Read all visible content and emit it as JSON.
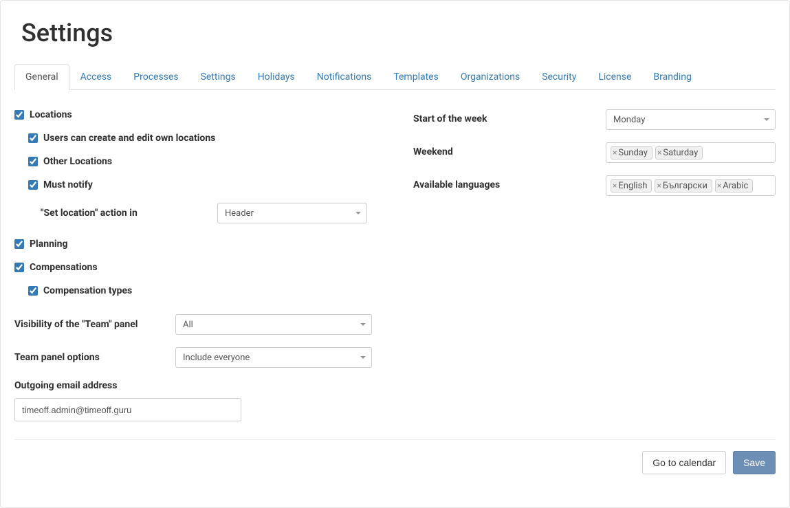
{
  "title": "Settings",
  "tabs": [
    {
      "label": "General",
      "active": true
    },
    {
      "label": "Access"
    },
    {
      "label": "Processes"
    },
    {
      "label": "Settings"
    },
    {
      "label": "Holidays"
    },
    {
      "label": "Notifications"
    },
    {
      "label": "Templates"
    },
    {
      "label": "Organizations"
    },
    {
      "label": "Security"
    },
    {
      "label": "License"
    },
    {
      "label": "Branding"
    }
  ],
  "left": {
    "locations_label": "Locations",
    "locations_checked": true,
    "users_edit_locations_label": "Users can create and edit own locations",
    "users_edit_locations_checked": true,
    "other_locations_label": "Other Locations",
    "other_locations_checked": true,
    "must_notify_label": "Must notify",
    "must_notify_checked": true,
    "set_location_action_label": "\"Set location\" action in",
    "set_location_action_value": "Header",
    "planning_label": "Planning",
    "planning_checked": true,
    "compensations_label": "Compensations",
    "compensations_checked": true,
    "compensation_types_label": "Compensation types",
    "compensation_types_checked": true,
    "visibility_team_panel_label": "Visibility of the \"Team\" panel",
    "visibility_team_panel_value": "All",
    "team_panel_options_label": "Team panel options",
    "team_panel_options_value": "Include everyone",
    "outgoing_email_label": "Outgoing email address",
    "outgoing_email_value": "timeoff.admin@timeoff.guru"
  },
  "right": {
    "start_week_label": "Start of the week",
    "start_week_value": "Monday",
    "weekend_label": "Weekend",
    "weekend_tags": [
      "Sunday",
      "Saturday"
    ],
    "languages_label": "Available languages",
    "language_tags": [
      "English",
      "Български",
      "Arabic"
    ]
  },
  "footer": {
    "go_calendar": "Go to calendar",
    "save": "Save"
  }
}
